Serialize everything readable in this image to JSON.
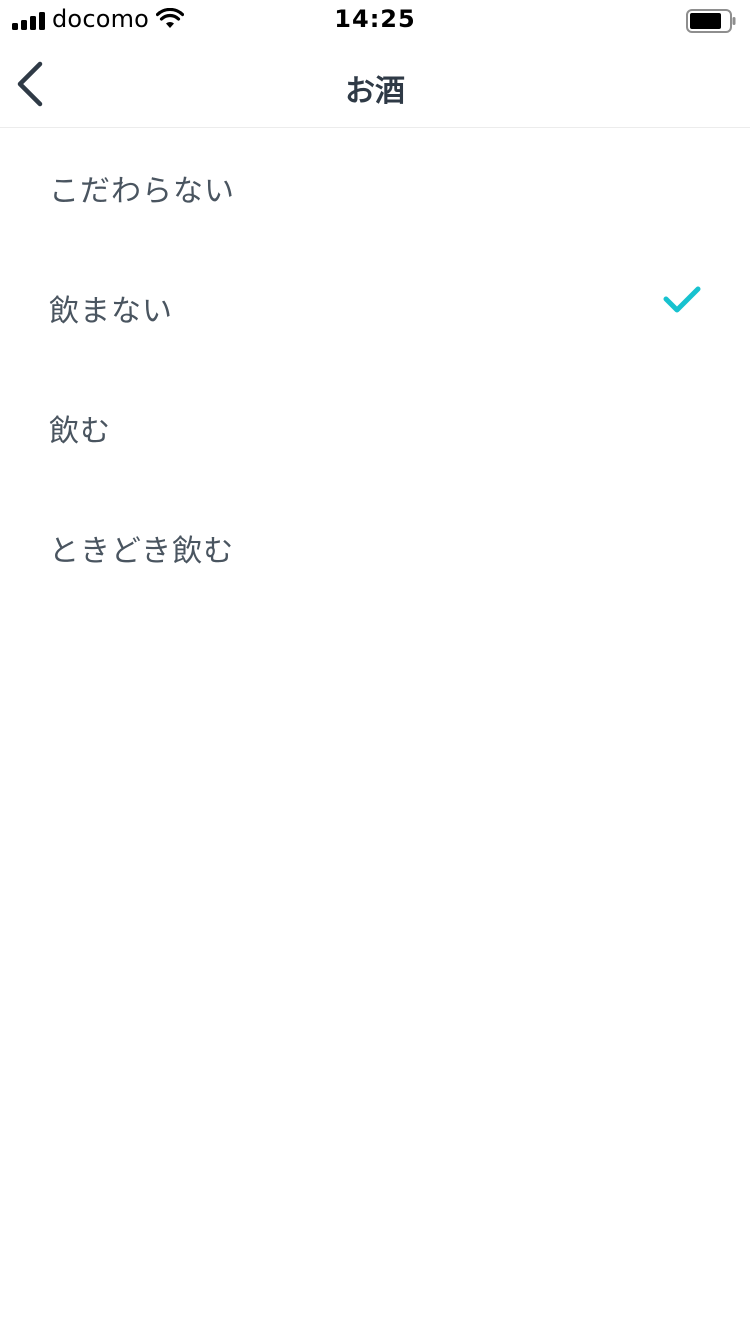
{
  "status_bar": {
    "carrier": "docomo",
    "time": "14:25",
    "signal_icon": "signal-bars-icon",
    "wifi_icon": "wifi-icon",
    "battery_icon": "battery-icon"
  },
  "nav": {
    "title": "お酒",
    "back_icon": "chevron-left-icon"
  },
  "options": [
    {
      "label": "こだわらない",
      "selected": false
    },
    {
      "label": "飲まない",
      "selected": false
    },
    {
      "label": "飲む",
      "selected": true
    },
    {
      "label": "ときどき飲む",
      "selected": false
    }
  ],
  "colors": {
    "accent": "#17c2cf",
    "text": "#4a5560",
    "title": "#2f3a46",
    "divider": "#ececec"
  }
}
